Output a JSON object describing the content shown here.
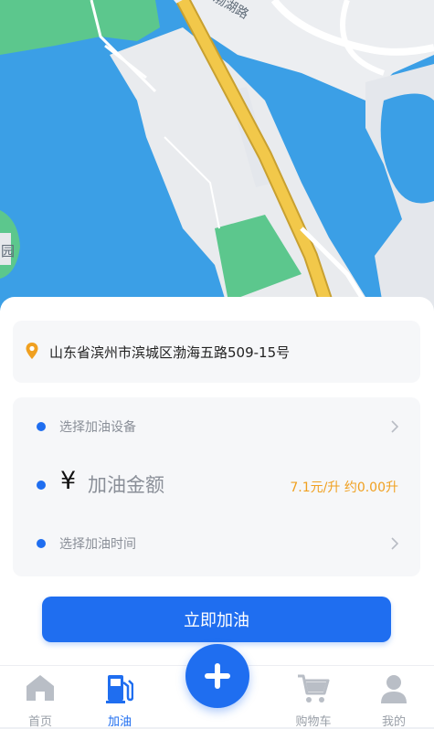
{
  "map": {
    "road_label": "渤湖路",
    "place_label": "园"
  },
  "address": {
    "icon": "location-pin-icon",
    "text": "山东省滨州市滨城区渤海五路509-15号"
  },
  "form": {
    "device_label": "选择加油设备",
    "amount_currency": "¥",
    "amount_placeholder": "加油金额",
    "price_info": "7.1元/升 约0.00升",
    "time_label": "选择加油时间"
  },
  "actions": {
    "refuel_button": "立即加油"
  },
  "tabbar": {
    "items": [
      {
        "label": "首页",
        "icon": "home-icon",
        "active": false
      },
      {
        "label": "加油",
        "icon": "fuel-pump-icon",
        "active": true
      },
      {
        "label": "购物车",
        "icon": "cart-icon",
        "active": false
      },
      {
        "label": "我的",
        "icon": "user-icon",
        "active": false
      }
    ],
    "center_icon": "plus-icon"
  },
  "colors": {
    "primary": "#1f6ef0",
    "accent_orange": "#f0a020",
    "water": "#3aa0e8",
    "park": "#5cc78d",
    "road": "#f2c84a"
  }
}
